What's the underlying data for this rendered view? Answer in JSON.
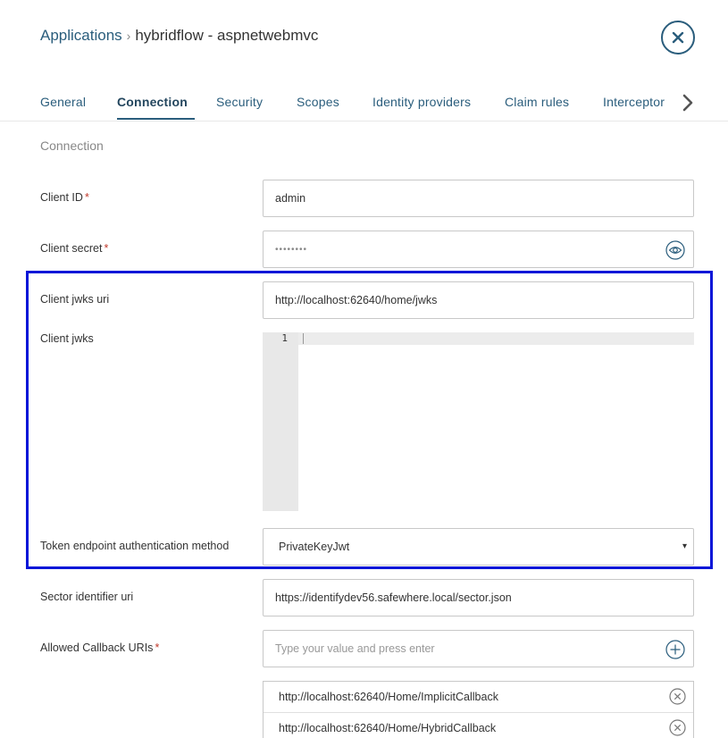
{
  "breadcrumb": {
    "parent": "Applications",
    "separator": "›",
    "current": "hybridflow - aspnetwebmvc"
  },
  "tabs": [
    {
      "label": "General",
      "active": false
    },
    {
      "label": "Connection",
      "active": true
    },
    {
      "label": "Security",
      "active": false
    },
    {
      "label": "Scopes",
      "active": false
    },
    {
      "label": "Identity providers",
      "active": false
    },
    {
      "label": "Claim rules",
      "active": false
    },
    {
      "label": "Interceptor",
      "active": false
    }
  ],
  "section": {
    "title": "Connection"
  },
  "form": {
    "client_id": {
      "label": "Client ID",
      "required": "*",
      "value": "admin"
    },
    "client_secret": {
      "label": "Client secret",
      "required": "*",
      "value": "••••••••"
    },
    "client_jwks_uri": {
      "label": "Client jwks uri",
      "value": "http://localhost:62640/home/jwks"
    },
    "client_jwks": {
      "label": "Client jwks",
      "line_number": "1",
      "value": ""
    },
    "token_endpoint_auth": {
      "label": "Token endpoint authentication method",
      "value": "PrivateKeyJwt",
      "caret": "▾"
    },
    "sector_identifier_uri": {
      "label": "Sector identifier uri",
      "value": "https://identifydev56.safewhere.local/sector.json"
    },
    "allowed_callback_uris": {
      "label": "Allowed Callback URIs",
      "required": "*",
      "placeholder": "Type your value and press enter",
      "items": [
        "http://localhost:62640/Home/ImplicitCallback",
        "http://localhost:62640/Home/HybridCallback"
      ]
    }
  },
  "icons": {
    "close": "close-icon",
    "next": "chevron-right-icon",
    "eye": "eye-icon",
    "plus": "plus-circle-icon",
    "remove": "close-circle-icon"
  },
  "colors": {
    "accent": "#2a5d7c",
    "required": "#c0392b",
    "highlight_border": "#0a17d8"
  }
}
